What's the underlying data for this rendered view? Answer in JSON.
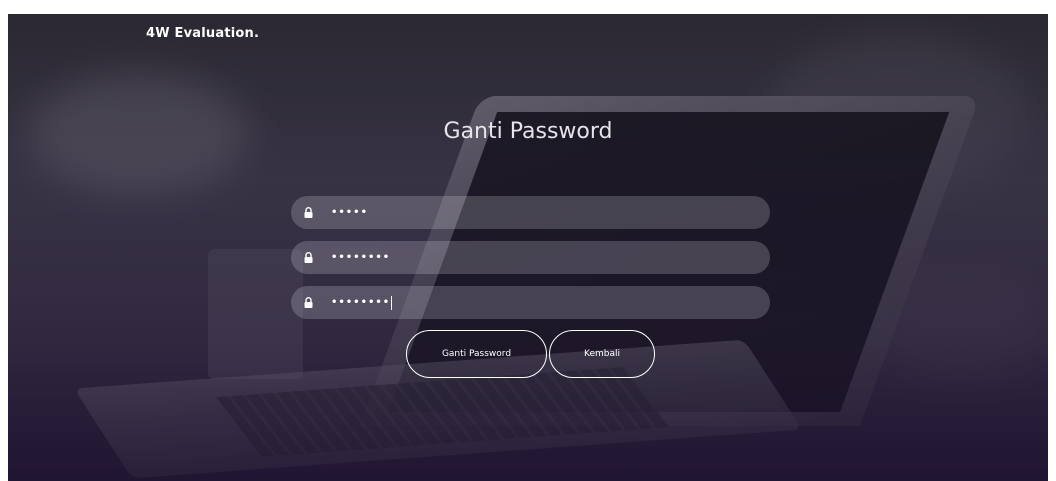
{
  "brand": {
    "label": "4W Evaluation."
  },
  "form": {
    "title": "Ganti Password",
    "fields": [
      {
        "name": "old-password-field",
        "masked_value": "•••••",
        "icon": "lock-icon"
      },
      {
        "name": "new-password-field",
        "masked_value": "••••••••",
        "icon": "lock-icon"
      },
      {
        "name": "confirm-password-field",
        "masked_value": "••••••••",
        "icon": "lock-icon",
        "focused": true
      }
    ],
    "buttons": {
      "submit_label": "Ganti Password",
      "back_label": "Kembali"
    }
  },
  "colors": {
    "text": "#ffffff",
    "field_bg": "rgba(225,222,232,0.22)",
    "background_dark": "#241b33"
  }
}
